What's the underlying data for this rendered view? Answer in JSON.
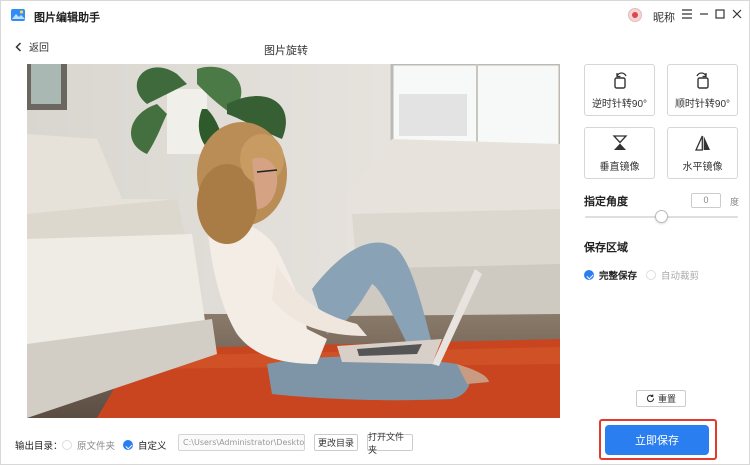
{
  "app": {
    "title": "图片编辑助手",
    "nickname": "昵称"
  },
  "header": {
    "back_label": "返回",
    "page_title": "图片旋转"
  },
  "tools": {
    "rotate_ccw": "逆时针转90°",
    "rotate_cw": "顺时针转90°",
    "flip_vertical": "垂直镜像",
    "flip_horizontal": "水平镜像"
  },
  "angle": {
    "label": "指定角度",
    "value": "0",
    "unit": "度",
    "slider_fraction": 0.5
  },
  "save_area": {
    "label": "保存区域",
    "options": [
      "完整保存",
      "自动裁剪"
    ],
    "selected": "完整保存"
  },
  "reset_label": "重置",
  "output": {
    "label": "输出目录：",
    "options": [
      "原文件夹",
      "自定义"
    ],
    "selected": "自定义",
    "path": "C:\\Users\\Administrator\\Desktop\\图",
    "change_dir_label": "更改目录",
    "open_dir_label": "打开文件夹"
  },
  "save_now_label": "立即保存",
  "colors": {
    "accent": "#2b7ef0",
    "highlight": "#e33a2c"
  }
}
